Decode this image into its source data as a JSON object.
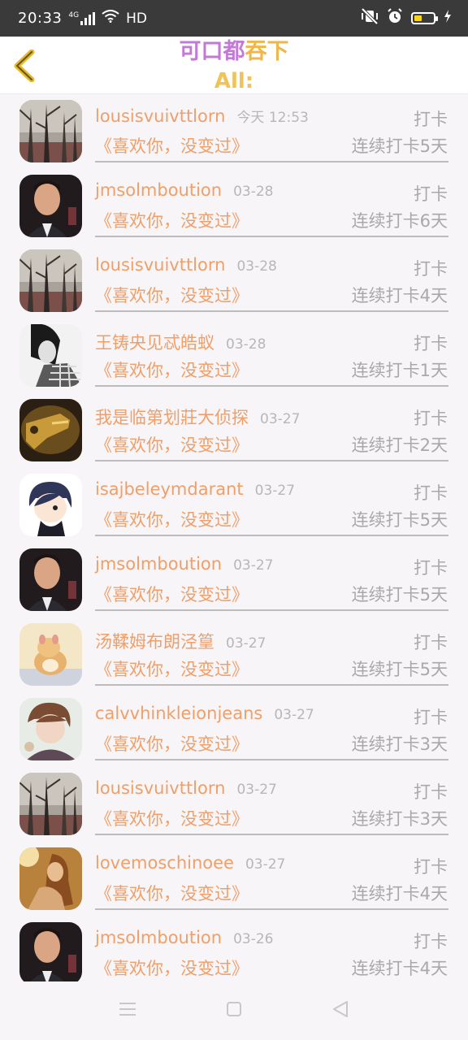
{
  "status_bar": {
    "time": "20:33",
    "network": "4G",
    "hd": "HD",
    "battery_level": 0.25
  },
  "header": {
    "title_part1": "可口都",
    "title_part2": "吞下",
    "subtitle": "All:"
  },
  "colors": {
    "accent_orange": "#ef9f6a",
    "title_purple": "#c27ad6",
    "title_yellow": "#f0b64a"
  },
  "rows": [
    {
      "username": "lousisvuivttlorn",
      "date": "今天 12:53",
      "action": "打卡",
      "song": "《喜欢你，没变过》",
      "streak": "连续打卡5天",
      "avatar": "forest-avatar"
    },
    {
      "username": "jmsolmboution",
      "date": "03-28",
      "action": "打卡",
      "song": "《喜欢你，没变过》",
      "streak": "连续打卡6天",
      "avatar": "man-avatar"
    },
    {
      "username": "lousisvuivttlorn",
      "date": "03-28",
      "action": "打卡",
      "song": "《喜欢你，没变过》",
      "streak": "连续打卡4天",
      "avatar": "forest-avatar"
    },
    {
      "username": "王铸央见忒皓蚁",
      "date": "03-28",
      "action": "打卡",
      "song": "《喜欢你，没变过》",
      "streak": "连续打卡1天",
      "avatar": "girl-bw-avatar"
    },
    {
      "username": "我是临第划莊大侦探",
      "date": "03-27",
      "action": "打卡",
      "song": "《喜欢你，没变过》",
      "streak": "连续打卡2天",
      "avatar": "gun-avatar"
    },
    {
      "username": "isajbeleymdarant",
      "date": "03-27",
      "action": "打卡",
      "song": "《喜欢你，没变过》",
      "streak": "连续打卡5天",
      "avatar": "anime-avatar"
    },
    {
      "username": "jmsolmboution",
      "date": "03-27",
      "action": "打卡",
      "song": "《喜欢你，没变过》",
      "streak": "连续打卡5天",
      "avatar": "man-avatar"
    },
    {
      "username": "汤鞣姆布朗泾篁",
      "date": "03-27",
      "action": "打卡",
      "song": "《喜欢你，没变过》",
      "streak": "连续打卡5天",
      "avatar": "hamster-avatar"
    },
    {
      "username": "calvvhinkleionjeans",
      "date": "03-27",
      "action": "打卡",
      "song": "《喜欢你，没变过》",
      "streak": "连续打卡3天",
      "avatar": "anime-boy-avatar"
    },
    {
      "username": "lousisvuivttlorn",
      "date": "03-27",
      "action": "打卡",
      "song": "《喜欢你，没变过》",
      "streak": "连续打卡3天",
      "avatar": "forest-avatar"
    },
    {
      "username": "lovemoschinoee",
      "date": "03-27",
      "action": "打卡",
      "song": "《喜欢你，没变过》",
      "streak": "连续打卡4天",
      "avatar": "woman-avatar"
    },
    {
      "username": "jmsolmboution",
      "date": "03-26",
      "action": "打卡",
      "song": "《喜欢你，没变过》",
      "streak": "连续打卡4天",
      "avatar": "man-avatar"
    }
  ],
  "nav": {
    "menu_icon": "menu-icon",
    "home_icon": "home-icon",
    "back_icon": "triangle-back-icon"
  }
}
